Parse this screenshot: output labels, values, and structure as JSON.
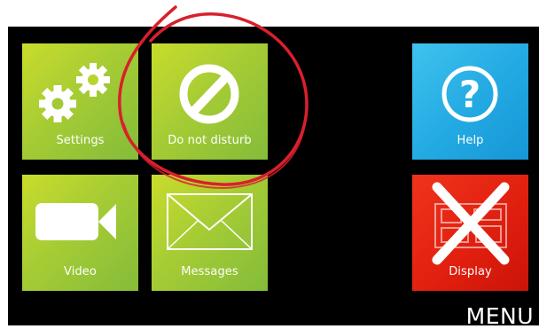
{
  "screen": {
    "tiles": [
      {
        "label": "Settings",
        "icon": "gears-icon"
      },
      {
        "label": "Do not disturb",
        "icon": "no-entry-icon"
      },
      {
        "label": "Help",
        "icon": "question-mark-icon"
      },
      {
        "label": "Video",
        "icon": "video-camera-icon"
      },
      {
        "label": "Messages",
        "icon": "envelope-icon"
      },
      {
        "label": "Display",
        "icon": "display-crossed-icon"
      }
    ],
    "menu_label": "MENU"
  },
  "colors": {
    "background": "#000000",
    "tile_green": "#a6cc34",
    "tile_blue": "#22a9e2",
    "tile_red": "#e01e0e",
    "annotation_red": "#d8202c"
  }
}
